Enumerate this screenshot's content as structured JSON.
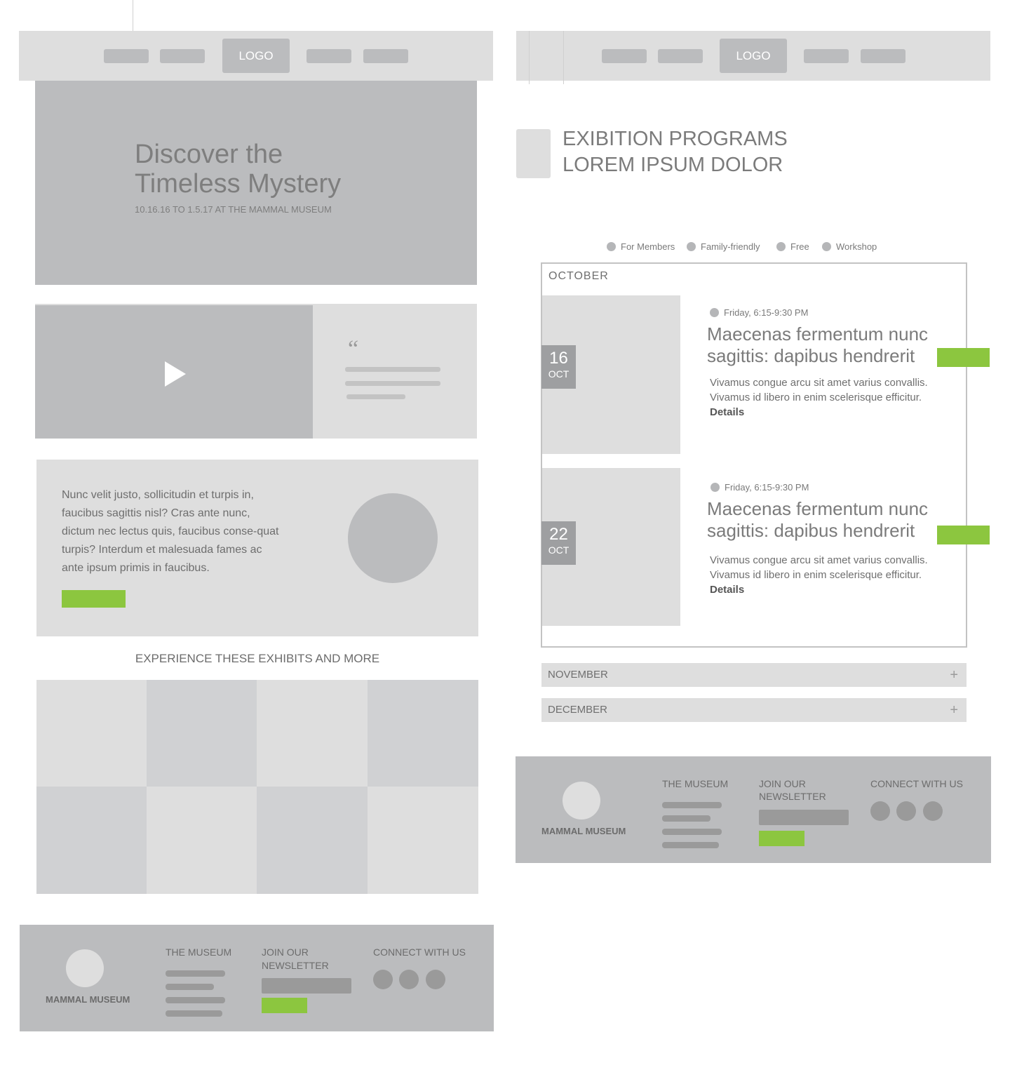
{
  "left": {
    "nav": {
      "logo_label": "LOGO"
    },
    "hero": {
      "title_line1": "Discover the",
      "title_line2": "Timeless Mystery",
      "subtitle": "10.16.16 TO 1.5.17 AT THE MAMMAL MUSEUM"
    },
    "quote": {
      "mark": "“"
    },
    "feature": {
      "paragraph": "Nunc velit justo, sollicitudin et turpis in, faucibus sagittis nisl? Cras ante nunc, dictum nec lectus quis, faucibus conse-quat turpis? Interdum et malesuada fames ac ante ipsum primis in faucibus."
    },
    "exhibits": {
      "heading": "EXPERIENCE THESE EXHIBITS AND MORE"
    },
    "footer": {
      "brand": "MAMMAL MUSEUM",
      "museum_heading": "THE MUSEUM",
      "newsletter_heading_line1": "JOIN OUR",
      "newsletter_heading_line2": "NEWSLETTER",
      "connect_heading": "CONNECT WITH US"
    }
  },
  "right": {
    "nav": {
      "logo_label": "LOGO"
    },
    "page_title_line1": "EXIBITION PROGRAMS",
    "page_title_line2": "LOREM IPSUM DOLOR",
    "legend": [
      "For Members",
      "Family-friendly",
      "Free",
      "Workshop"
    ],
    "month_open": "OCTOBER",
    "events": [
      {
        "day": "16",
        "month": "OCT",
        "time": "Friday, 6:15-9:30 PM",
        "title": "Maecenas fermentum nunc sagittis: dapibus hendrerit",
        "desc": "Vivamus congue arcu sit amet varius convallis. Vivamus id libero in enim scelerisque efficitur.",
        "details": "Details"
      },
      {
        "day": "22",
        "month": "OCT",
        "time": "Friday, 6:15-9:30 PM",
        "title": "Maecenas fermentum nunc sagittis: dapibus hendrerit",
        "desc": "Vivamus congue arcu sit amet varius convallis. Vivamus id libero in enim scelerisque efficitur.",
        "details": "Details"
      }
    ],
    "months_collapsed": [
      "NOVEMBER",
      "DECEMBER"
    ],
    "plus": "+",
    "footer": {
      "brand": "MAMMAL MUSEUM",
      "museum_heading": "THE MUSEUM",
      "newsletter_heading_line1": "JOIN OUR",
      "newsletter_heading_line2": "NEWSLETTER",
      "connect_heading": "CONNECT WITH US"
    }
  },
  "colors": {
    "accent": "#8cc63f",
    "panel_light": "#dedede",
    "panel_mid": "#bbbcbe"
  }
}
